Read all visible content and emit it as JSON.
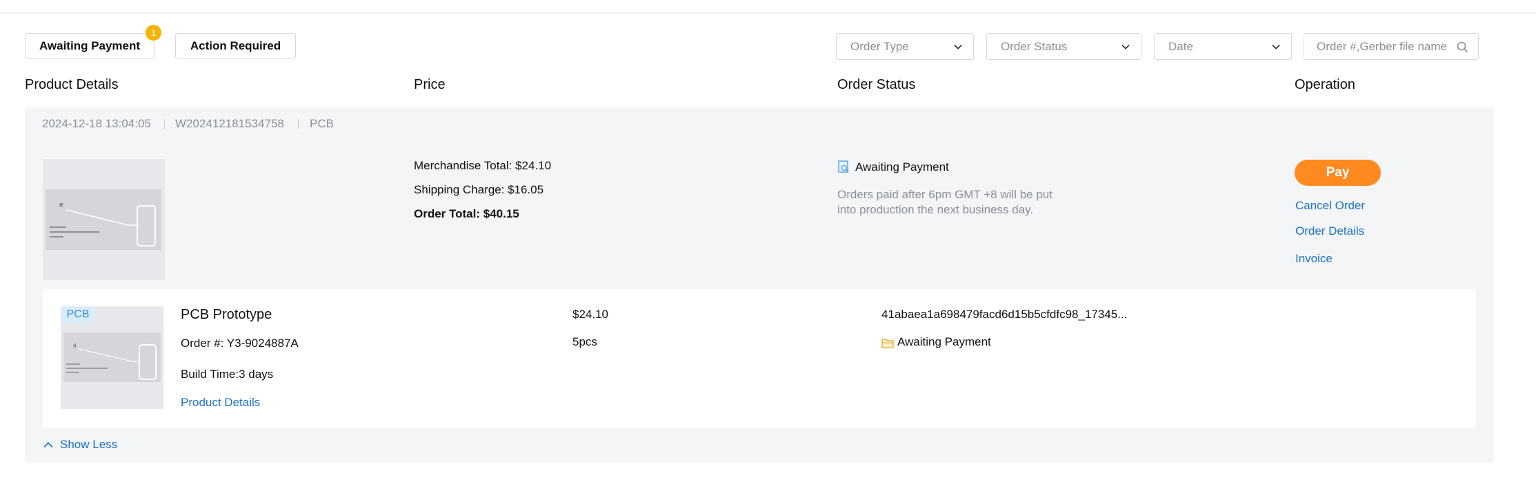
{
  "tabs": {
    "awaiting_payment": "Awaiting Payment",
    "awaiting_payment_badge": "1",
    "action_required": "Action Required"
  },
  "filters": {
    "order_type": "Order Type",
    "order_status": "Order Status",
    "date": "Date",
    "search_placeholder": "Order #,Gerber file name"
  },
  "columns": {
    "product_details": "Product Details",
    "price": "Price",
    "order_status": "Order Status",
    "operation": "Operation"
  },
  "order": {
    "datetime": "2024-12-18 13:04:05",
    "number": "W202412181534758",
    "category": "PCB",
    "merchandise_total": "Merchandise Total: $24.10",
    "shipping_charge": "Shipping Charge: $16.05",
    "order_total": "Order Total: $40.15",
    "status": "Awaiting Payment",
    "status_note_line1": "Orders paid after 6pm GMT +8 will be put",
    "status_note_line2": "into production the next business day.",
    "actions": {
      "pay": "Pay",
      "cancel": "Cancel Order",
      "details": "Order Details",
      "invoice": "Invoice"
    }
  },
  "item": {
    "tag": "PCB",
    "name": "PCB Prototype",
    "order_no": "Order #: Y3-9024887A",
    "build_time": "Build Time:3 days",
    "details_link": "Product Details",
    "price": "$24.10",
    "quantity": "5pcs",
    "file_name": "41abaea1a698479facd6d15b5cfdfc98_17345...",
    "status": "Awaiting Payment"
  },
  "show_less": "Show Less",
  "colors": {
    "accent_orange": "#ff8a1f",
    "link_blue": "#1a73c7",
    "badge_yellow": "#f5b400",
    "card_bg": "#f4f5f7"
  }
}
